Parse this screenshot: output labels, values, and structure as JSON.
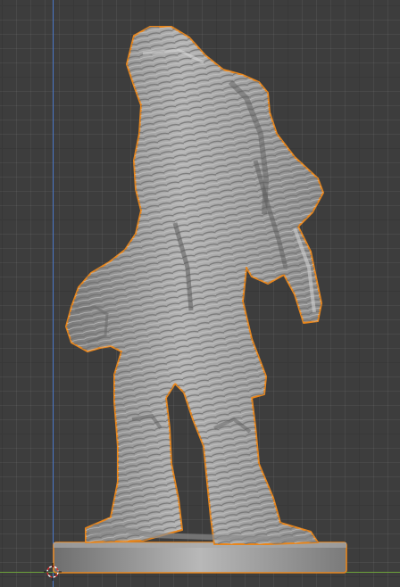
{
  "viewport": {
    "background": "#3d3d3d",
    "grid": true,
    "object": "mummy-figure-on-base",
    "selected": true,
    "selection_outline_color": "#e8861c",
    "axis_z_color": "#4a78c8",
    "axis_y_color": "#6da23a",
    "cursor_icon": "3d-cursor-icon"
  }
}
